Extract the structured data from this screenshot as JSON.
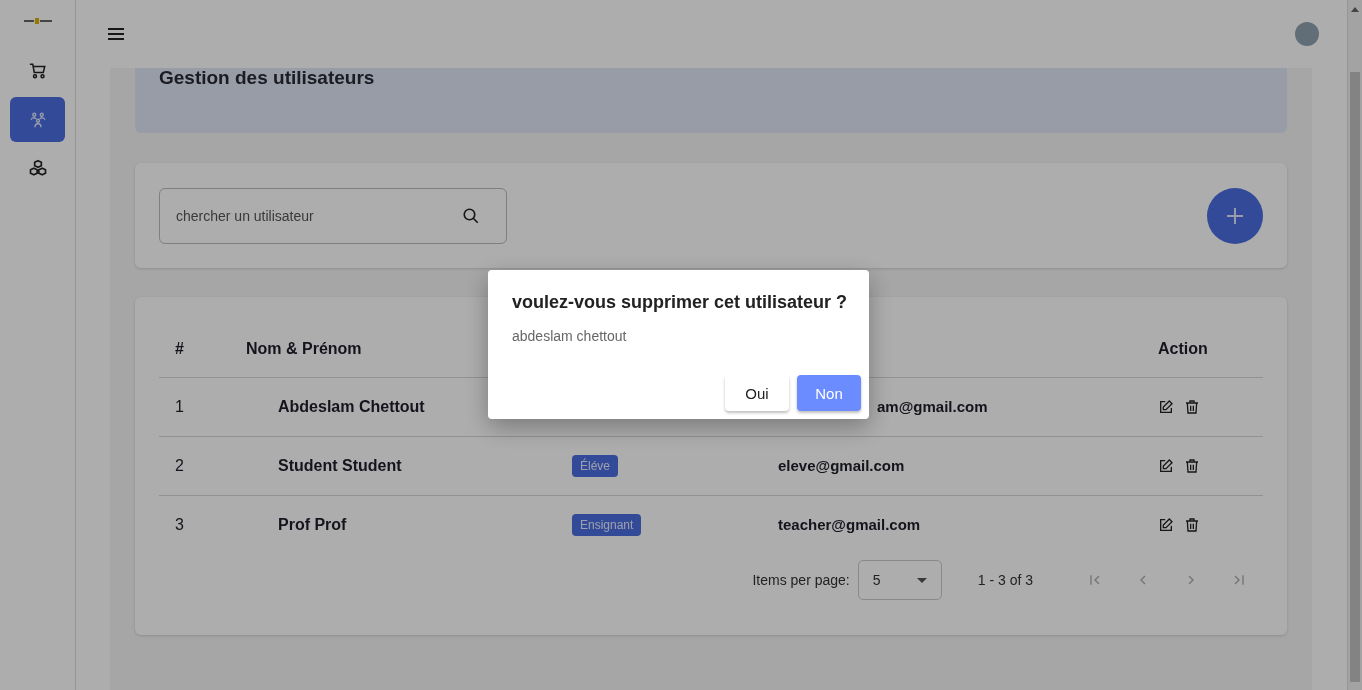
{
  "sidebar": {
    "items": [
      {
        "selected": false
      },
      {
        "selected": true
      },
      {
        "selected": false
      }
    ]
  },
  "page_title": "Gestion des utilisateurs",
  "search": {
    "placeholder": "chercher un utilisateur"
  },
  "table": {
    "columns": [
      "#",
      "Nom & Prénom",
      "Action"
    ],
    "rows": [
      {
        "number": "1",
        "name": "Abdeslam Chettout",
        "email": "am@gmail.com",
        "under_dialog": true
      },
      {
        "number": "2",
        "name": "Student Student",
        "role": "Éléve",
        "email": "eleve@gmail.com",
        "under_dialog": false
      },
      {
        "number": "3",
        "name": "Prof Prof",
        "role": "Ensignant",
        "email": "teacher@gmail.com",
        "under_dialog": false
      }
    ]
  },
  "paginator": {
    "label": "Items per page:",
    "page_size": "5",
    "range": "1 - 3 of 3",
    "nav": [
      {
        "disabled": true
      },
      {
        "disabled": true
      },
      {
        "disabled": true
      },
      {
        "disabled": true
      }
    ]
  },
  "dialog": {
    "title": "voulez-vous supprimer cet utilisateur ?",
    "message": "abdeslam chettout",
    "buttons": [
      {
        "label": "Oui",
        "primary": false
      },
      {
        "label": "Non",
        "primary": true
      }
    ]
  }
}
